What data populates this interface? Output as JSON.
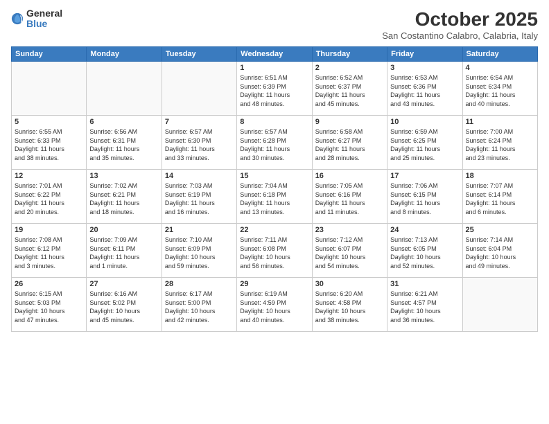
{
  "logo": {
    "general": "General",
    "blue": "Blue"
  },
  "header": {
    "month": "October 2025",
    "location": "San Costantino Calabro, Calabria, Italy"
  },
  "weekdays": [
    "Sunday",
    "Monday",
    "Tuesday",
    "Wednesday",
    "Thursday",
    "Friday",
    "Saturday"
  ],
  "weeks": [
    [
      {
        "day": "",
        "info": ""
      },
      {
        "day": "",
        "info": ""
      },
      {
        "day": "",
        "info": ""
      },
      {
        "day": "1",
        "info": "Sunrise: 6:51 AM\nSunset: 6:39 PM\nDaylight: 11 hours\nand 48 minutes."
      },
      {
        "day": "2",
        "info": "Sunrise: 6:52 AM\nSunset: 6:37 PM\nDaylight: 11 hours\nand 45 minutes."
      },
      {
        "day": "3",
        "info": "Sunrise: 6:53 AM\nSunset: 6:36 PM\nDaylight: 11 hours\nand 43 minutes."
      },
      {
        "day": "4",
        "info": "Sunrise: 6:54 AM\nSunset: 6:34 PM\nDaylight: 11 hours\nand 40 minutes."
      }
    ],
    [
      {
        "day": "5",
        "info": "Sunrise: 6:55 AM\nSunset: 6:33 PM\nDaylight: 11 hours\nand 38 minutes."
      },
      {
        "day": "6",
        "info": "Sunrise: 6:56 AM\nSunset: 6:31 PM\nDaylight: 11 hours\nand 35 minutes."
      },
      {
        "day": "7",
        "info": "Sunrise: 6:57 AM\nSunset: 6:30 PM\nDaylight: 11 hours\nand 33 minutes."
      },
      {
        "day": "8",
        "info": "Sunrise: 6:57 AM\nSunset: 6:28 PM\nDaylight: 11 hours\nand 30 minutes."
      },
      {
        "day": "9",
        "info": "Sunrise: 6:58 AM\nSunset: 6:27 PM\nDaylight: 11 hours\nand 28 minutes."
      },
      {
        "day": "10",
        "info": "Sunrise: 6:59 AM\nSunset: 6:25 PM\nDaylight: 11 hours\nand 25 minutes."
      },
      {
        "day": "11",
        "info": "Sunrise: 7:00 AM\nSunset: 6:24 PM\nDaylight: 11 hours\nand 23 minutes."
      }
    ],
    [
      {
        "day": "12",
        "info": "Sunrise: 7:01 AM\nSunset: 6:22 PM\nDaylight: 11 hours\nand 20 minutes."
      },
      {
        "day": "13",
        "info": "Sunrise: 7:02 AM\nSunset: 6:21 PM\nDaylight: 11 hours\nand 18 minutes."
      },
      {
        "day": "14",
        "info": "Sunrise: 7:03 AM\nSunset: 6:19 PM\nDaylight: 11 hours\nand 16 minutes."
      },
      {
        "day": "15",
        "info": "Sunrise: 7:04 AM\nSunset: 6:18 PM\nDaylight: 11 hours\nand 13 minutes."
      },
      {
        "day": "16",
        "info": "Sunrise: 7:05 AM\nSunset: 6:16 PM\nDaylight: 11 hours\nand 11 minutes."
      },
      {
        "day": "17",
        "info": "Sunrise: 7:06 AM\nSunset: 6:15 PM\nDaylight: 11 hours\nand 8 minutes."
      },
      {
        "day": "18",
        "info": "Sunrise: 7:07 AM\nSunset: 6:14 PM\nDaylight: 11 hours\nand 6 minutes."
      }
    ],
    [
      {
        "day": "19",
        "info": "Sunrise: 7:08 AM\nSunset: 6:12 PM\nDaylight: 11 hours\nand 3 minutes."
      },
      {
        "day": "20",
        "info": "Sunrise: 7:09 AM\nSunset: 6:11 PM\nDaylight: 11 hours\nand 1 minute."
      },
      {
        "day": "21",
        "info": "Sunrise: 7:10 AM\nSunset: 6:09 PM\nDaylight: 10 hours\nand 59 minutes."
      },
      {
        "day": "22",
        "info": "Sunrise: 7:11 AM\nSunset: 6:08 PM\nDaylight: 10 hours\nand 56 minutes."
      },
      {
        "day": "23",
        "info": "Sunrise: 7:12 AM\nSunset: 6:07 PM\nDaylight: 10 hours\nand 54 minutes."
      },
      {
        "day": "24",
        "info": "Sunrise: 7:13 AM\nSunset: 6:05 PM\nDaylight: 10 hours\nand 52 minutes."
      },
      {
        "day": "25",
        "info": "Sunrise: 7:14 AM\nSunset: 6:04 PM\nDaylight: 10 hours\nand 49 minutes."
      }
    ],
    [
      {
        "day": "26",
        "info": "Sunrise: 6:15 AM\nSunset: 5:03 PM\nDaylight: 10 hours\nand 47 minutes."
      },
      {
        "day": "27",
        "info": "Sunrise: 6:16 AM\nSunset: 5:02 PM\nDaylight: 10 hours\nand 45 minutes."
      },
      {
        "day": "28",
        "info": "Sunrise: 6:17 AM\nSunset: 5:00 PM\nDaylight: 10 hours\nand 42 minutes."
      },
      {
        "day": "29",
        "info": "Sunrise: 6:19 AM\nSunset: 4:59 PM\nDaylight: 10 hours\nand 40 minutes."
      },
      {
        "day": "30",
        "info": "Sunrise: 6:20 AM\nSunset: 4:58 PM\nDaylight: 10 hours\nand 38 minutes."
      },
      {
        "day": "31",
        "info": "Sunrise: 6:21 AM\nSunset: 4:57 PM\nDaylight: 10 hours\nand 36 minutes."
      },
      {
        "day": "",
        "info": ""
      }
    ]
  ]
}
